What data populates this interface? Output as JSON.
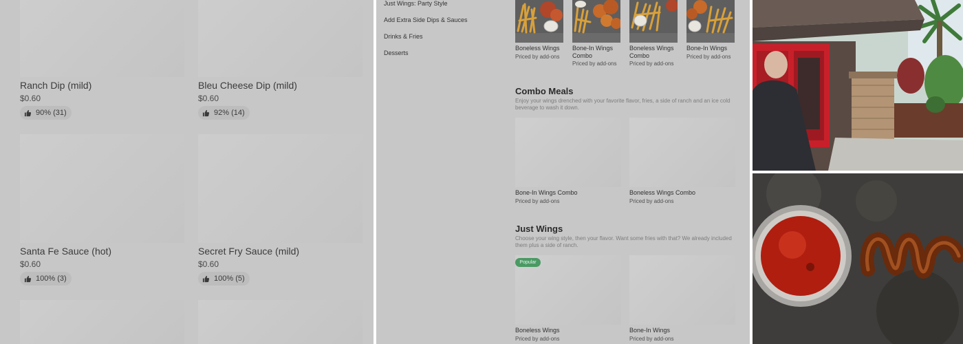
{
  "dips": [
    {
      "name": "Ranch Dip (mild)",
      "price": "$0.60",
      "rating": "90% (31)"
    },
    {
      "name": "Bleu Cheese Dip (mild)",
      "price": "$0.60",
      "rating": "92% (14)"
    },
    {
      "name": "Santa Fe Sauce (hot)",
      "price": "$0.60",
      "rating": "100% (3)"
    },
    {
      "name": "Secret Fry Sauce (mild)",
      "price": "$0.60",
      "rating": "100% (5)"
    }
  ],
  "menu_nav": [
    "Just Wings: Party Style",
    "Add Extra Side Dips & Sauces",
    "Drinks & Fries",
    "Desserts"
  ],
  "top_row": [
    {
      "name": "Boneless Wings",
      "sub": "Priced by add-ons"
    },
    {
      "name": "Bone-In Wings Combo",
      "sub": "Priced by add-ons"
    },
    {
      "name": "Boneless Wings Combo",
      "sub": "Priced by add-ons"
    },
    {
      "name": "Bone-In Wings",
      "sub": "Priced by add-ons"
    }
  ],
  "combo_meals": {
    "title": "Combo Meals",
    "description": "Enjoy your wings drenched with your favorite flavor, fries, a side of ranch and an ice cold beverage to wash it down.",
    "items": [
      {
        "name": "Bone-In Wings Combo",
        "sub": "Priced by add-ons"
      },
      {
        "name": "Boneless Wings Combo",
        "sub": "Priced by add-ons"
      }
    ]
  },
  "just_wings": {
    "title": "Just Wings",
    "description": "Choose your wing style, then your flavor. Want some fries with that? We already included them plus a side of ranch.",
    "badge": "Popular",
    "items": [
      {
        "name": "Boneless Wings",
        "sub": "Priced by add-ons"
      },
      {
        "name": "Bone-In Wings",
        "sub": "Priced by add-ons"
      }
    ]
  },
  "colors": {
    "overlay_gray": "#c7c7c7",
    "popular_badge": "#4a9a63",
    "door_red": "#c8202a",
    "sauce_red": "#b01e10"
  },
  "icons": [
    "thumbs-up-icon"
  ]
}
